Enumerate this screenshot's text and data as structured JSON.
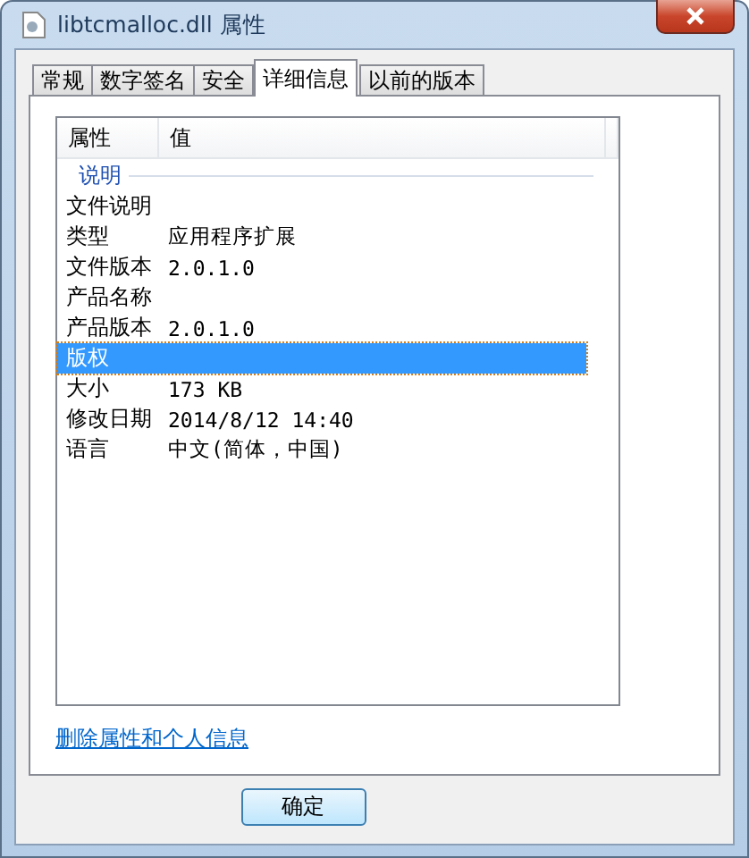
{
  "window": {
    "title": "libtcmalloc.dll 属性"
  },
  "tabs": [
    {
      "label": "常规",
      "selected": false
    },
    {
      "label": "数字签名",
      "selected": false
    },
    {
      "label": "安全",
      "selected": false
    },
    {
      "label": "详细信息",
      "selected": true
    },
    {
      "label": "以前的版本",
      "selected": false
    }
  ],
  "table": {
    "columns": [
      "属性",
      "值"
    ],
    "group": "说明",
    "rows": [
      {
        "name": "文件说明",
        "value": "",
        "selected": false
      },
      {
        "name": "类型",
        "value": "应用程序扩展",
        "selected": false
      },
      {
        "name": "文件版本",
        "value": "2.0.1.0",
        "selected": false
      },
      {
        "name": "产品名称",
        "value": "",
        "selected": false
      },
      {
        "name": "产品版本",
        "value": "2.0.1.0",
        "selected": false
      },
      {
        "name": "版权",
        "value": "",
        "selected": true
      },
      {
        "name": "大小",
        "value": "173 KB",
        "selected": false
      },
      {
        "name": "修改日期",
        "value": "2014/8/12 14:40",
        "selected": false
      },
      {
        "name": "语言",
        "value": "中文(简体，中国)",
        "selected": false
      }
    ]
  },
  "link": "删除属性和个人信息",
  "buttons": [
    "确定"
  ]
}
